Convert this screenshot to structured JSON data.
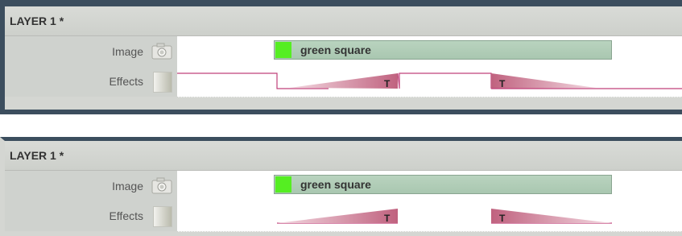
{
  "panels": [
    {
      "layer_title": "LAYER 1 *",
      "image_row": {
        "label": "Image",
        "icon": "camera-icon",
        "clip_label": "green square",
        "clip_color": "#55ee22"
      },
      "effects_row": {
        "label": "Effects",
        "transition_marker": "T"
      }
    },
    {
      "layer_title": "LAYER 1 *",
      "image_row": {
        "label": "Image",
        "icon": "camera-icon",
        "clip_label": "green square",
        "clip_color": "#55ee22"
      },
      "effects_row": {
        "label": "Effects",
        "transition_marker": "T"
      }
    }
  ],
  "colors": {
    "frame": "#3c4e5e",
    "effect_line": "#c0407a",
    "clip_fill": "#b9d3bf"
  }
}
